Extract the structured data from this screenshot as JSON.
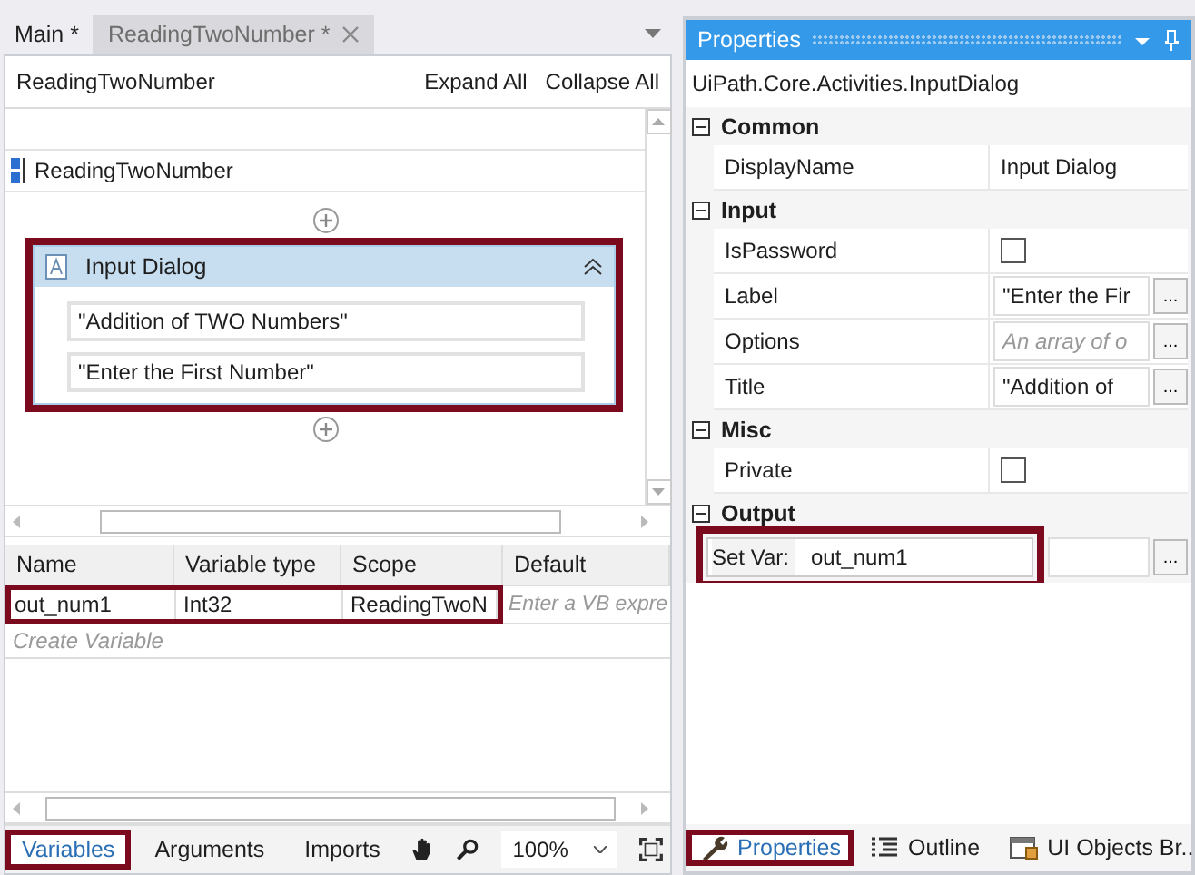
{
  "doc_tabs": [
    {
      "label": "Main *",
      "selected": false,
      "closable": false
    },
    {
      "label": "ReadingTwoNumber *",
      "selected": true,
      "closable": true
    }
  ],
  "breadcrumb": "ReadingTwoNumber",
  "expand_all": "Expand All",
  "collapse_all": "Collapse All",
  "sequence": {
    "title": "ReadingTwoNumber"
  },
  "activity": {
    "title": "Input Dialog",
    "highlighted": true,
    "fields": [
      "\"Addition of TWO Numbers\"",
      "\"Enter the First Number\""
    ]
  },
  "variables": {
    "columns": [
      "Name",
      "Variable type",
      "Scope",
      "Default"
    ],
    "rows": [
      {
        "name": "out_num1",
        "type": "Int32",
        "scope": "ReadingTwoN",
        "default_placeholder": "Enter a VB expre",
        "highlighted": true
      }
    ],
    "create": "Create Variable"
  },
  "bottom_tabs": [
    {
      "label": "Variables",
      "selected": true,
      "highlighted": true
    },
    {
      "label": "Arguments",
      "selected": false,
      "highlighted": false
    },
    {
      "label": "Imports",
      "selected": false,
      "highlighted": false
    }
  ],
  "zoom": "100%",
  "properties": {
    "title": "Properties",
    "type_name": "UiPath.Core.Activities.InputDialog",
    "categories": [
      {
        "name": "Common",
        "expanded": true,
        "rows": [
          {
            "kind": "text",
            "label": "DisplayName",
            "value": "Input Dialog"
          }
        ]
      },
      {
        "name": "Input",
        "expanded": true,
        "rows": [
          {
            "kind": "checkbox",
            "label": "IsPassword",
            "checked": false
          },
          {
            "kind": "expr",
            "label": "Label",
            "value": "\"Enter the Fir",
            "button": "..."
          },
          {
            "kind": "expr",
            "label": "Options",
            "placeholder": "An array of o",
            "button": "..."
          },
          {
            "kind": "expr",
            "label": "Title",
            "value": "\"Addition of",
            "button": "..."
          }
        ]
      },
      {
        "name": "Misc",
        "expanded": true,
        "rows": [
          {
            "kind": "checkbox",
            "label": "Private",
            "checked": false
          }
        ]
      },
      {
        "name": "Output",
        "expanded": true,
        "rows": [
          {
            "kind": "setvar",
            "label": "Set Var:",
            "value": "out_num1",
            "button": "...",
            "highlighted": true
          }
        ]
      }
    ]
  },
  "dock_tabs": [
    {
      "label": "Properties",
      "selected": true,
      "highlighted": true
    },
    {
      "label": "Outline",
      "selected": false,
      "highlighted": false
    },
    {
      "label": "UI Objects Br...",
      "selected": false,
      "highlighted": false
    }
  ]
}
